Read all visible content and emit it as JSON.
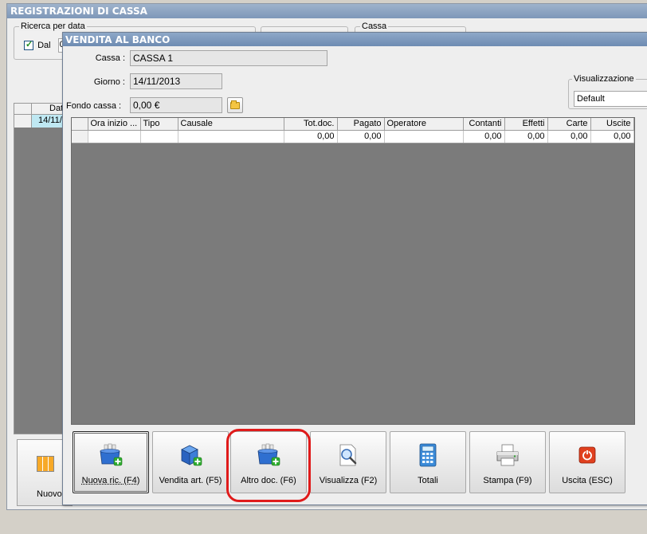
{
  "background_window": {
    "title": "REGISTRAZIONI DI CASSA",
    "search_group_label": "Ricerca per data",
    "from_checkbox_label": "Dal",
    "from_value": "0",
    "cassa_group_label": "Cassa",
    "grid_header": "Dat",
    "grid_row_value": "14/11/",
    "new_button_label": "Nuovo ("
  },
  "window": {
    "title": "VENDITA AL BANCO",
    "cassa_label": "Cassa :",
    "cassa_value": "CASSA 1",
    "giorno_label": "Giorno :",
    "giorno_value": "14/11/2013",
    "fondo_label": "Fondo cassa :",
    "fondo_value": "0,00 €",
    "visualizzazione_label": "Visualizzazione",
    "visualizzazione_value": "Default"
  },
  "grid": {
    "columns": [
      "Ora inizio ...",
      "Tipo",
      "Causale",
      "Tot.doc.",
      "Pagato",
      "Operatore",
      "Contanti",
      "Effetti",
      "Carte",
      "Uscite"
    ],
    "rows": [
      [
        "",
        "",
        "",
        "0,00",
        "0,00",
        "",
        "0,00",
        "0,00",
        "0,00",
        "0,00"
      ]
    ]
  },
  "toolbar": {
    "buttons": [
      {
        "label": "Nuova ric. (F4)",
        "icon": "box-add-icon"
      },
      {
        "label": "Vendita art. (F5)",
        "icon": "cube-add-icon"
      },
      {
        "label": "Altro doc. (F6)",
        "icon": "box-add-icon"
      },
      {
        "label": "Visualizza (F2)",
        "icon": "magnifier-document-icon"
      },
      {
        "label": "Totali",
        "icon": "calculator-icon"
      },
      {
        "label": "Stampa (F9)",
        "icon": "printer-icon"
      },
      {
        "label": "Uscita (ESC)",
        "icon": "power-exit-icon"
      }
    ]
  },
  "colors": {
    "title_bar": "#7e97b8",
    "grid_bg": "#7b7b7b",
    "highlight": "#e01b1b",
    "selected_row": "#bfe8f2"
  }
}
